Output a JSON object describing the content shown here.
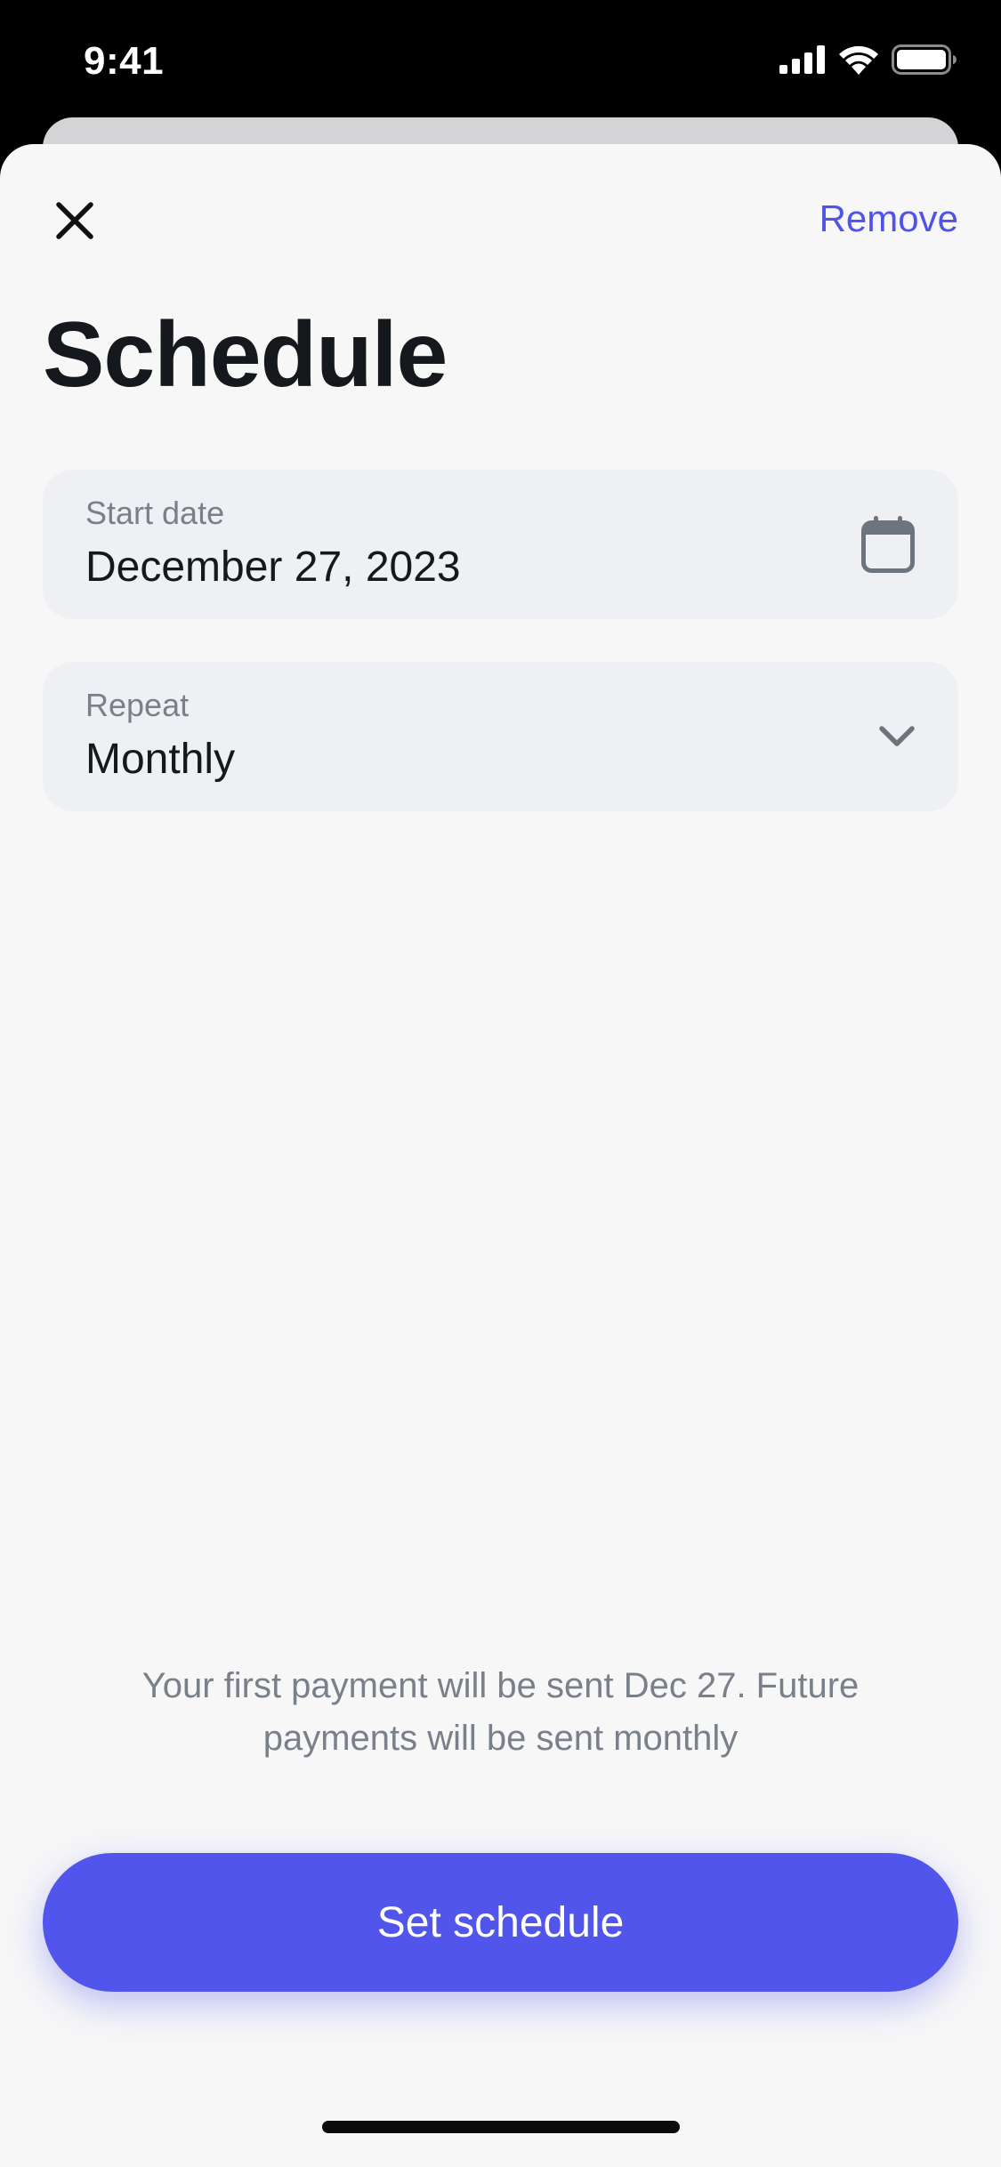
{
  "status_bar": {
    "time": "9:41"
  },
  "header": {
    "remove_label": "Remove",
    "title": "Schedule"
  },
  "fields": {
    "start_date": {
      "label": "Start date",
      "value": "December 27, 2023"
    },
    "repeat": {
      "label": "Repeat",
      "value": "Monthly"
    }
  },
  "info": {
    "text": "Your first payment will be sent Dec 27. Future payments will be sent monthly"
  },
  "actions": {
    "primary_label": "Set schedule"
  },
  "icons": {
    "close": "close-icon",
    "calendar": "calendar-icon",
    "chevron": "chevron-down-icon",
    "signal": "cellular-signal-icon",
    "wifi": "wifi-icon",
    "battery": "battery-icon"
  },
  "colors": {
    "accent": "#5155ec",
    "link": "#4f53e8",
    "sheet_background": "#f7f7f8",
    "field_background": "#eef0f3",
    "text_primary": "#15181c",
    "text_secondary": "#7a8089"
  }
}
